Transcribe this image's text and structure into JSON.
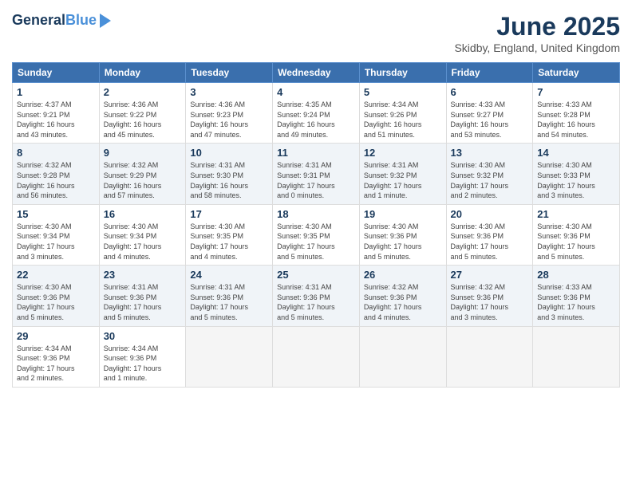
{
  "header": {
    "logo_line1": "General",
    "logo_line2": "Blue",
    "title": "June 2025",
    "subtitle": "Skidby, England, United Kingdom"
  },
  "columns": [
    "Sunday",
    "Monday",
    "Tuesday",
    "Wednesday",
    "Thursday",
    "Friday",
    "Saturday"
  ],
  "weeks": [
    [
      {
        "num": "1",
        "info": "Sunrise: 4:37 AM\nSunset: 9:21 PM\nDaylight: 16 hours\nand 43 minutes."
      },
      {
        "num": "2",
        "info": "Sunrise: 4:36 AM\nSunset: 9:22 PM\nDaylight: 16 hours\nand 45 minutes."
      },
      {
        "num": "3",
        "info": "Sunrise: 4:36 AM\nSunset: 9:23 PM\nDaylight: 16 hours\nand 47 minutes."
      },
      {
        "num": "4",
        "info": "Sunrise: 4:35 AM\nSunset: 9:24 PM\nDaylight: 16 hours\nand 49 minutes."
      },
      {
        "num": "5",
        "info": "Sunrise: 4:34 AM\nSunset: 9:26 PM\nDaylight: 16 hours\nand 51 minutes."
      },
      {
        "num": "6",
        "info": "Sunrise: 4:33 AM\nSunset: 9:27 PM\nDaylight: 16 hours\nand 53 minutes."
      },
      {
        "num": "7",
        "info": "Sunrise: 4:33 AM\nSunset: 9:28 PM\nDaylight: 16 hours\nand 54 minutes."
      }
    ],
    [
      {
        "num": "8",
        "info": "Sunrise: 4:32 AM\nSunset: 9:28 PM\nDaylight: 16 hours\nand 56 minutes."
      },
      {
        "num": "9",
        "info": "Sunrise: 4:32 AM\nSunset: 9:29 PM\nDaylight: 16 hours\nand 57 minutes."
      },
      {
        "num": "10",
        "info": "Sunrise: 4:31 AM\nSunset: 9:30 PM\nDaylight: 16 hours\nand 58 minutes."
      },
      {
        "num": "11",
        "info": "Sunrise: 4:31 AM\nSunset: 9:31 PM\nDaylight: 17 hours\nand 0 minutes."
      },
      {
        "num": "12",
        "info": "Sunrise: 4:31 AM\nSunset: 9:32 PM\nDaylight: 17 hours\nand 1 minute."
      },
      {
        "num": "13",
        "info": "Sunrise: 4:30 AM\nSunset: 9:32 PM\nDaylight: 17 hours\nand 2 minutes."
      },
      {
        "num": "14",
        "info": "Sunrise: 4:30 AM\nSunset: 9:33 PM\nDaylight: 17 hours\nand 3 minutes."
      }
    ],
    [
      {
        "num": "15",
        "info": "Sunrise: 4:30 AM\nSunset: 9:34 PM\nDaylight: 17 hours\nand 3 minutes."
      },
      {
        "num": "16",
        "info": "Sunrise: 4:30 AM\nSunset: 9:34 PM\nDaylight: 17 hours\nand 4 minutes."
      },
      {
        "num": "17",
        "info": "Sunrise: 4:30 AM\nSunset: 9:35 PM\nDaylight: 17 hours\nand 4 minutes."
      },
      {
        "num": "18",
        "info": "Sunrise: 4:30 AM\nSunset: 9:35 PM\nDaylight: 17 hours\nand 5 minutes."
      },
      {
        "num": "19",
        "info": "Sunrise: 4:30 AM\nSunset: 9:36 PM\nDaylight: 17 hours\nand 5 minutes."
      },
      {
        "num": "20",
        "info": "Sunrise: 4:30 AM\nSunset: 9:36 PM\nDaylight: 17 hours\nand 5 minutes."
      },
      {
        "num": "21",
        "info": "Sunrise: 4:30 AM\nSunset: 9:36 PM\nDaylight: 17 hours\nand 5 minutes."
      }
    ],
    [
      {
        "num": "22",
        "info": "Sunrise: 4:30 AM\nSunset: 9:36 PM\nDaylight: 17 hours\nand 5 minutes."
      },
      {
        "num": "23",
        "info": "Sunrise: 4:31 AM\nSunset: 9:36 PM\nDaylight: 17 hours\nand 5 minutes."
      },
      {
        "num": "24",
        "info": "Sunrise: 4:31 AM\nSunset: 9:36 PM\nDaylight: 17 hours\nand 5 minutes."
      },
      {
        "num": "25",
        "info": "Sunrise: 4:31 AM\nSunset: 9:36 PM\nDaylight: 17 hours\nand 5 minutes."
      },
      {
        "num": "26",
        "info": "Sunrise: 4:32 AM\nSunset: 9:36 PM\nDaylight: 17 hours\nand 4 minutes."
      },
      {
        "num": "27",
        "info": "Sunrise: 4:32 AM\nSunset: 9:36 PM\nDaylight: 17 hours\nand 3 minutes."
      },
      {
        "num": "28",
        "info": "Sunrise: 4:33 AM\nSunset: 9:36 PM\nDaylight: 17 hours\nand 3 minutes."
      }
    ],
    [
      {
        "num": "29",
        "info": "Sunrise: 4:34 AM\nSunset: 9:36 PM\nDaylight: 17 hours\nand 2 minutes."
      },
      {
        "num": "30",
        "info": "Sunrise: 4:34 AM\nSunset: 9:36 PM\nDaylight: 17 hours\nand 1 minute."
      },
      {
        "num": "",
        "info": ""
      },
      {
        "num": "",
        "info": ""
      },
      {
        "num": "",
        "info": ""
      },
      {
        "num": "",
        "info": ""
      },
      {
        "num": "",
        "info": ""
      }
    ]
  ]
}
